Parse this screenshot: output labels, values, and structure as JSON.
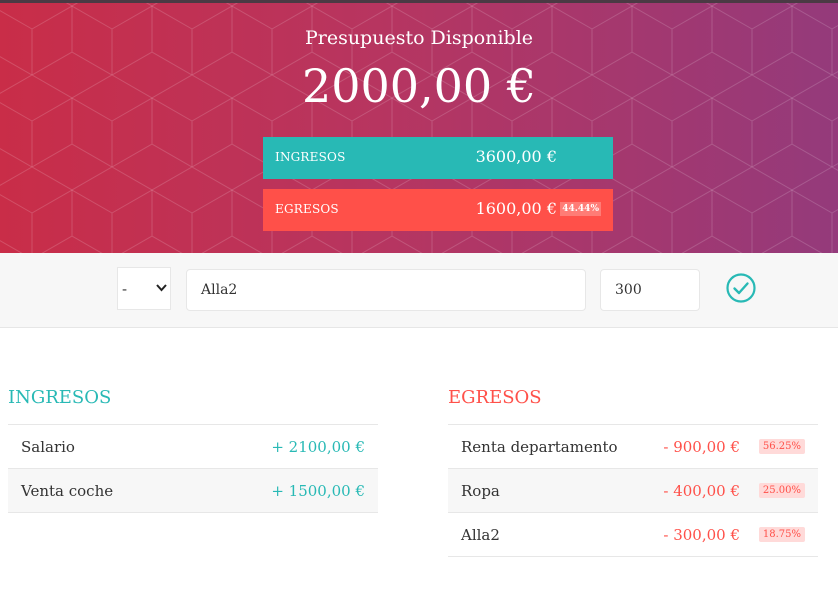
{
  "header": {
    "title": "Presupuesto Disponible",
    "total": "2000,00 €",
    "income_label": "INGRESOS",
    "income_value": "3600,00 €",
    "expense_label": "EGRESOS",
    "expense_value": "1600,00 €",
    "expense_percentage": "44.44%"
  },
  "form": {
    "type_selected": "-",
    "description_value": "Alla2",
    "amount_value": "300",
    "add_icon": "check-circle-icon"
  },
  "income": {
    "title": "INGRESOS",
    "items": [
      {
        "description": "Salario",
        "value": "+ 2100,00 €"
      },
      {
        "description": "Venta coche",
        "value": "+ 1500,00 €"
      }
    ]
  },
  "expenses": {
    "title": "EGRESOS",
    "items": [
      {
        "description": "Renta departamento",
        "value": "- 900,00 €",
        "percentage": "56.25%"
      },
      {
        "description": "Ropa",
        "value": "- 400,00 €",
        "percentage": "25.00%"
      },
      {
        "description": "Alla2",
        "value": "- 300,00 €",
        "percentage": "18.75%"
      }
    ]
  },
  "colors": {
    "income": "#28b9b5",
    "expense": "#ff5049"
  }
}
